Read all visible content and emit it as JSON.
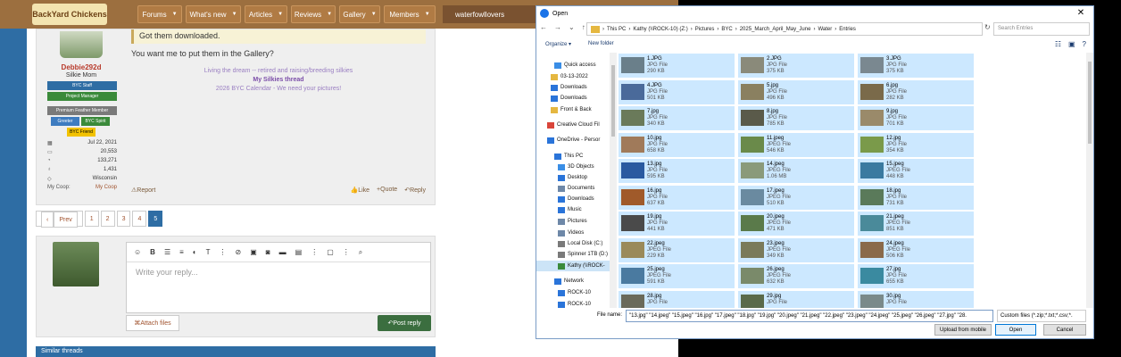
{
  "forum": {
    "logo_text": "BackYard Chickens",
    "nav": [
      "Forums",
      "What's new",
      "Articles",
      "Reviews",
      "Gallery",
      "Members"
    ],
    "username_chip": "waterfowllovers",
    "post": {
      "quote_text": "Got them downloaded.",
      "body": "You want me to put them in the Gallery?",
      "author": "Debbie292d",
      "author_title": "Silkie Mom",
      "badges": [
        "BYC Staff",
        "Project Manager",
        "Premium Feather Member",
        "Greeter",
        "BYC Spirit",
        "BYC Friend"
      ],
      "badge_colors": [
        "#2e6da4",
        "#3a8a3a",
        "#7a7a7a",
        "#3e7cc0",
        "#3a8a3a",
        "#f2c200"
      ],
      "stats": [
        {
          "icon": "calendar-icon",
          "value": "Jul 22, 2021"
        },
        {
          "icon": "message-icon",
          "value": "20,553"
        },
        {
          "icon": "thumb-icon",
          "value": "133,271"
        },
        {
          "icon": "trophy-icon",
          "value": "1,431"
        },
        {
          "icon": "location-icon",
          "value": "Wisconsin"
        }
      ],
      "coop_label": "My Coop:",
      "coop_link": "My Coop",
      "signature": [
        "Living the dream -- retired and raising/breeding silkies",
        "My Silkies thread",
        "2026 BYC Calendar - We need your pictures!"
      ],
      "report": "Report",
      "like": "Like",
      "quote": "+Quote",
      "reply": "Reply"
    },
    "pager": {
      "prev": "Prev",
      "pages": [
        "1",
        "2",
        "3",
        "4",
        "5"
      ],
      "current": "5"
    },
    "reply_placeholder": "Write your reply...",
    "attach_files": "Attach files",
    "post_reply": "Post reply",
    "similar_threads": "Similar threads"
  },
  "dialog": {
    "title": "Open",
    "close": "✕",
    "breadcrumb": [
      "This PC",
      "Kathy (\\\\ROCK-10) (Z:)",
      "Pictures",
      "BYC",
      "2025_March_April_May_June",
      "Water",
      "Entries"
    ],
    "search_placeholder": "Search Entries",
    "organize": "Organize",
    "new_folder": "New folder",
    "nav": [
      {
        "label": "Quick access",
        "icon": "star-icon",
        "color": "#3a8ee6"
      },
      {
        "label": "03-13-2022",
        "icon": "folder-icon",
        "color": "#e5b740"
      },
      {
        "label": "Downloads",
        "icon": "download-icon",
        "color": "#2a74d9"
      },
      {
        "label": "Downloads",
        "icon": "download-icon",
        "color": "#2a74d9"
      },
      {
        "label": "Front & Back",
        "icon": "folder-icon",
        "color": "#e5b740"
      },
      {
        "label": "Creative Cloud Fil",
        "icon": "cloud-icon",
        "color": "#d9453a"
      },
      {
        "label": "OneDrive - Persor",
        "icon": "cloud-icon",
        "color": "#2a74d9"
      },
      {
        "label": "This PC",
        "icon": "pc-icon",
        "color": "#2a74d9"
      },
      {
        "label": "3D Objects",
        "icon": "cube-icon",
        "color": "#3a8ee6"
      },
      {
        "label": "Desktop",
        "icon": "desktop-icon",
        "color": "#2a74d9"
      },
      {
        "label": "Documents",
        "icon": "doc-icon",
        "color": "#6e88a8"
      },
      {
        "label": "Downloads",
        "icon": "download-icon",
        "color": "#2a74d9"
      },
      {
        "label": "Music",
        "icon": "music-icon",
        "color": "#2a74d9"
      },
      {
        "label": "Pictures",
        "icon": "picture-icon",
        "color": "#6e88a8"
      },
      {
        "label": "Videos",
        "icon": "video-icon",
        "color": "#6e88a8"
      },
      {
        "label": "Local Disk (C:)",
        "icon": "drive-icon",
        "color": "#7a7a7a"
      },
      {
        "label": "Spinner 1TB (D:)",
        "icon": "drive-icon",
        "color": "#7a7a7a"
      },
      {
        "label": "Kathy (\\\\ROCK-",
        "icon": "network-drive-icon",
        "color": "#3a8a3a"
      },
      {
        "label": "Network",
        "icon": "network-icon",
        "color": "#2a74d9"
      },
      {
        "label": "ROCK-10",
        "icon": "pc-icon",
        "color": "#2a74d9"
      },
      {
        "label": "ROCK-10",
        "icon": "pc-icon",
        "color": "#2a74d9"
      }
    ],
    "files": [
      {
        "name": "1.JPG",
        "type": "JPG File",
        "size": "290 KB",
        "color": "#6a7f8a"
      },
      {
        "name": "2.JPG",
        "type": "JPG File",
        "size": "375 KB",
        "color": "#8a8a7a"
      },
      {
        "name": "3.JPG",
        "type": "JPG File",
        "size": "375 KB",
        "color": "#7a8890"
      },
      {
        "name": "4.JPG",
        "type": "JPG File",
        "size": "501 KB",
        "color": "#4a6a9a"
      },
      {
        "name": "5.jpg",
        "type": "JPG File",
        "size": "496 KB",
        "color": "#8a8060"
      },
      {
        "name": "6.jpg",
        "type": "JPG File",
        "size": "282 KB",
        "color": "#7a6a4a"
      },
      {
        "name": "7.jpg",
        "type": "JPG File",
        "size": "340 KB",
        "color": "#6a7a5a"
      },
      {
        "name": "8.jpg",
        "type": "JPG File",
        "size": "785 KB",
        "color": "#5a5a4a"
      },
      {
        "name": "9.jpg",
        "type": "JPG File",
        "size": "701 KB",
        "color": "#9a8a6a"
      },
      {
        "name": "10.jpg",
        "type": "JPG File",
        "size": "658 KB",
        "color": "#a07a5a"
      },
      {
        "name": "11.jpeg",
        "type": "JPEG File",
        "size": "546 KB",
        "color": "#6a8a4a"
      },
      {
        "name": "12.jpg",
        "type": "JPG File",
        "size": "354 KB",
        "color": "#7a9a4a"
      },
      {
        "name": "13.jpg",
        "type": "JPG File",
        "size": "595 KB",
        "color": "#2a5aa0"
      },
      {
        "name": "14.jpeg",
        "type": "JPEG File",
        "size": "1.06 MB",
        "color": "#8a9a7a"
      },
      {
        "name": "15.jpeg",
        "type": "JPEG File",
        "size": "448 KB",
        "color": "#3a7aa0"
      },
      {
        "name": "16.jpg",
        "type": "JPG File",
        "size": "637 KB",
        "color": "#a05a2a"
      },
      {
        "name": "17.jpeg",
        "type": "JPEG File",
        "size": "510 KB",
        "color": "#6a8aa0"
      },
      {
        "name": "18.jpg",
        "type": "JPG File",
        "size": "731 KB",
        "color": "#5a7a5a"
      },
      {
        "name": "19.jpg",
        "type": "JPG File",
        "size": "441 KB",
        "color": "#4a4a4a"
      },
      {
        "name": "20.jpeg",
        "type": "JPEG File",
        "size": "471 KB",
        "color": "#5a7a4a"
      },
      {
        "name": "21.jpeg",
        "type": "JPEG File",
        "size": "851 KB",
        "color": "#4a8a9a"
      },
      {
        "name": "22.jpeg",
        "type": "JPEG File",
        "size": "229 KB",
        "color": "#9a8a5a"
      },
      {
        "name": "23.jpeg",
        "type": "JPEG File",
        "size": "349 KB",
        "color": "#7a7a5a"
      },
      {
        "name": "24.jpeg",
        "type": "JPEG File",
        "size": "506 KB",
        "color": "#8a6a4a"
      },
      {
        "name": "25.jpeg",
        "type": "JPEG File",
        "size": "591 KB",
        "color": "#4a7aa0"
      },
      {
        "name": "26.jpeg",
        "type": "JPEG File",
        "size": "632 KB",
        "color": "#7a8a6a"
      },
      {
        "name": "27.jpg",
        "type": "JPG File",
        "size": "655 KB",
        "color": "#3a8aa0"
      },
      {
        "name": "28.jpg",
        "type": "JPG File",
        "size": "",
        "color": "#6a6a5a"
      },
      {
        "name": "29.jpg",
        "type": "JPG File",
        "size": "",
        "color": "#5a6a4a"
      },
      {
        "name": "30.jpg",
        "type": "JPG File",
        "size": "",
        "color": "#7a8a8a"
      }
    ],
    "file_name_label": "File name:",
    "file_name_value": "\"13.jpg\" \"14.jpeg\" \"15.jpeg\" \"16.jpg\" \"17.jpeg\" \"18.jpg\" \"19.jpg\" \"20.jpeg\" \"21.jpeg\" \"22.jpeg\" \"23.jpeg\" \"24.jpeg\" \"25.jpeg\" \"26.jpeg\" \"27.jpg\" \"28.",
    "file_type": "Custom files (*.zip;*.txt;*.csv;*.",
    "upload_mobile": "Upload from mobile",
    "open": "Open",
    "cancel": "Cancel"
  }
}
